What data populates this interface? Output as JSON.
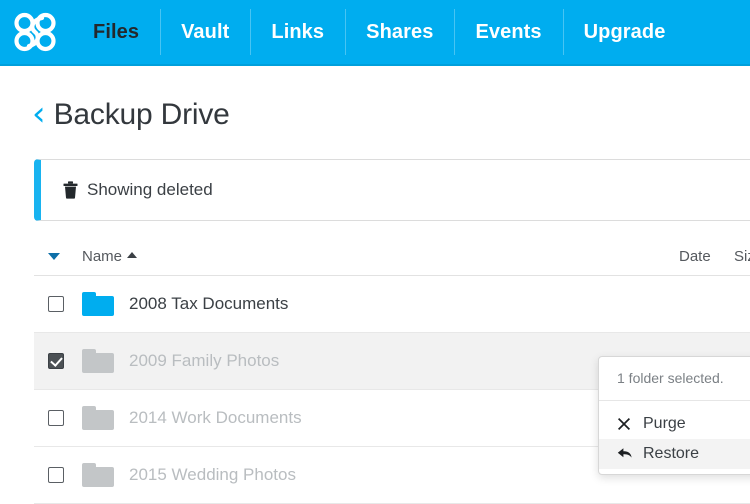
{
  "brand": {
    "logo_icon": "interlocking-rings-logo"
  },
  "nav": {
    "items": [
      {
        "label": "Files",
        "active": true
      },
      {
        "label": "Vault",
        "active": false
      },
      {
        "label": "Links",
        "active": false
      },
      {
        "label": "Shares",
        "active": false
      },
      {
        "label": "Events",
        "active": false
      },
      {
        "label": "Upgrade",
        "active": false
      }
    ]
  },
  "page": {
    "back_icon": "chevron-left-icon",
    "back_glyph": "‹",
    "title": "Backup Drive"
  },
  "alert": {
    "icon": "trash-icon",
    "text": "Showing deleted",
    "accent_color": "#18b3f0"
  },
  "table": {
    "headers": {
      "select_all_icon": "caret-down-icon",
      "name": "Name",
      "name_sort_icon": "caret-up-icon",
      "date": "Date",
      "size": "Size"
    },
    "rows": [
      {
        "name": "2008 Tax Documents",
        "icon": "folder-icon",
        "folder_color": "#00adef",
        "checked": false,
        "deleted": false,
        "date": "",
        "size": ""
      },
      {
        "name": "2009 Family Photos",
        "icon": "folder-icon",
        "folder_color": "#c3c6c8",
        "checked": true,
        "deleted": true,
        "date": "",
        "size": ""
      },
      {
        "name": "2014 Work Documents",
        "icon": "folder-icon",
        "folder_color": "#c3c6c8",
        "checked": false,
        "deleted": true,
        "date": "",
        "size": ""
      },
      {
        "name": "2015 Wedding Photos",
        "icon": "folder-icon",
        "folder_color": "#c3c6c8",
        "checked": false,
        "deleted": true,
        "date": "",
        "size": ""
      }
    ]
  },
  "popup": {
    "status": "1 folder selected.",
    "items": [
      {
        "label": "Purge",
        "icon": "close-x-icon",
        "glyph": "✖",
        "hover": false
      },
      {
        "label": "Restore",
        "icon": "undo-arrow-icon",
        "glyph": "↰",
        "hover": true
      }
    ]
  },
  "colors": {
    "brand_blue": "#00adef",
    "nav_border": "#00a0dc",
    "text_dark": "#3b4045",
    "text_muted": "#b9bdc0"
  }
}
